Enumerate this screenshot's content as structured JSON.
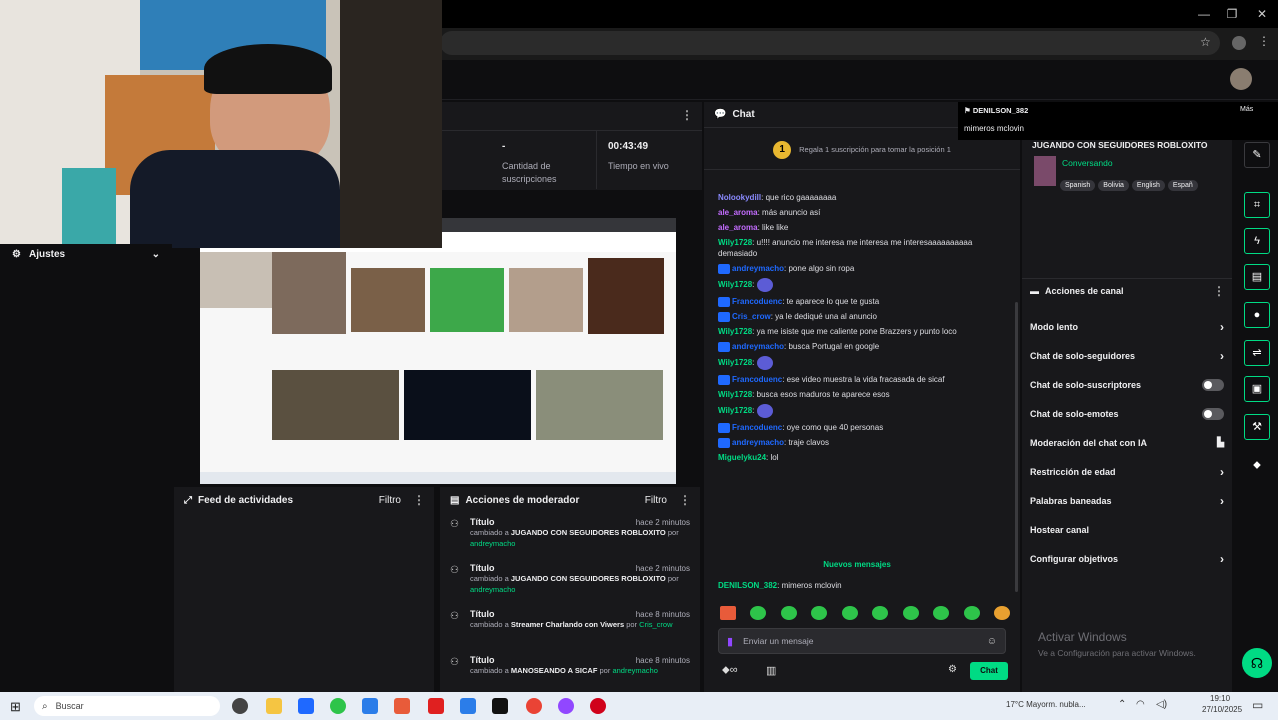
{
  "window": {
    "minimize": "—",
    "maximize": "❐",
    "close": "✕"
  },
  "colors": {
    "accent": "#00db84",
    "twitch_purple": "#9147ff",
    "bg": "#0e0e10",
    "panel": "#18181b"
  },
  "stats": [
    {
      "value": "-",
      "label": "Cantidad de suscripciones"
    },
    {
      "value": "00:43:49",
      "label": "Tiempo en vivo"
    }
  ],
  "ajustes": {
    "label": "Ajustes"
  },
  "feed": {
    "title": "Feed de actividades",
    "filter": "Filtro"
  },
  "mod_actions": {
    "title": "Acciones de moderador",
    "filter": "Filtro",
    "items": [
      {
        "title": "Título",
        "time": "hace 2 minutos",
        "prefix": "cambiado a",
        "value": "JUGANDO CON SEGUIDORES ROBLOXITO",
        "by": "por",
        "user": "andreymacho"
      },
      {
        "title": "Título",
        "time": "hace 2 minutos",
        "prefix": "cambiado a",
        "value": "JUGANDO CON SEGUIDORES ROBLOXITO",
        "by": "por",
        "user": "andreymacho"
      },
      {
        "title": "Título",
        "time": "hace 8 minutos",
        "prefix": "cambiado a",
        "value": "Streamer Charlando con Viwers",
        "by": "por",
        "user": "Cris_crow"
      },
      {
        "title": "Título",
        "time": "hace 8 minutos",
        "prefix": "cambiado a",
        "value": "MANOSEANDO A SICAF",
        "by": "por",
        "user": "andreymacho"
      }
    ]
  },
  "chat": {
    "title": "Chat",
    "pinned": "Regala 1 suscripción para tomar la posición 1",
    "messages": [
      {
        "user": "Nolookydill",
        "color": "#8a8aff",
        "text": ": que rico gaaaaaaaa",
        "badge": false
      },
      {
        "user": "ale_aroma",
        "color": "#c36cff",
        "text": ": más anuncio así",
        "badge": false
      },
      {
        "user": "ale_aroma",
        "color": "#c36cff",
        "text": ": like like",
        "badge": false
      },
      {
        "user": "Wily1728",
        "color": "#00db84",
        "text": ": u!!!! anuncio me interesa me interesa me interesaaaaaaaaaa demasiado",
        "badge": false
      },
      {
        "user": "andreymacho",
        "color": "#1f69ff",
        "text": ": pone algo sin ropa",
        "badge": true
      },
      {
        "user": "Wily1728",
        "color": "#00db84",
        "text": ":",
        "badge": false,
        "emote": true
      },
      {
        "user": "Francoduenc",
        "color": "#1f69ff",
        "text": ": te aparece lo que te gusta",
        "badge": true
      },
      {
        "user": "Cris_crow",
        "color": "#1f69ff",
        "text": ": ya le dediqué una al anuncio",
        "badge": true
      },
      {
        "user": "Wily1728",
        "color": "#00db84",
        "text": ": ya me isiste que me caliente pone Brazzers y punto loco",
        "badge": false
      },
      {
        "user": "andreymacho",
        "color": "#1f69ff",
        "text": ": busca Portugal en google",
        "badge": true
      },
      {
        "user": "Wily1728",
        "color": "#00db84",
        "text": ":",
        "badge": false,
        "emote": true
      },
      {
        "user": "Francoduenc",
        "color": "#1f69ff",
        "text": ": ese video muestra la vida fracasada de sicaf",
        "badge": true
      },
      {
        "user": "Wily1728",
        "color": "#00db84",
        "text": ": busca esos maduros te aparece esos",
        "badge": false
      },
      {
        "user": "Wily1728",
        "color": "#00db84",
        "text": ":",
        "badge": false,
        "emote": true
      },
      {
        "user": "Francoduenc",
        "color": "#1f69ff",
        "text": ": oye como que 40 personas",
        "badge": true
      },
      {
        "user": "andreymacho",
        "color": "#1f69ff",
        "text": ": traje clavos",
        "badge": true
      },
      {
        "user": "Miguelyku24",
        "color": "#00db84",
        "text": ": lol",
        "badge": false
      }
    ],
    "new_messages": "Nuevos mensajes",
    "last": {
      "user": "DENILSON_382",
      "text": ": mimeros mclovin"
    },
    "input_placeholder": "Enviar un mensaje",
    "send_label": "Chat"
  },
  "popup": {
    "user": "DENILSON_382",
    "action": "Más",
    "text": "mimeros mclovin"
  },
  "stream_info": {
    "title": "JUGANDO CON SEGUIDORES ROBLOXITO",
    "category": "Conversando",
    "tags": [
      "Spanish",
      "Bolivia",
      "English",
      "Españ"
    ]
  },
  "channel_actions": {
    "title": "Acciones de canal",
    "items": [
      {
        "label": "Modo lento",
        "control": "chevron"
      },
      {
        "label": "Chat de solo-seguidores",
        "control": "chevron"
      },
      {
        "label": "Chat de solo-suscriptores",
        "control": "toggle"
      },
      {
        "label": "Chat de solo-emotes",
        "control": "toggle"
      },
      {
        "label": "Moderación del chat con IA",
        "control": "chart"
      },
      {
        "label": "Restricción de edad",
        "control": "chevron"
      },
      {
        "label": "Palabras baneadas",
        "control": "chevron"
      },
      {
        "label": "Hostear canal",
        "control": "none"
      },
      {
        "label": "Configurar objetivos",
        "control": "chevron"
      }
    ]
  },
  "watermark": {
    "title": "Activar Windows",
    "subtitle": "Ve a Configuración para activar Windows."
  },
  "taskbar": {
    "search_placeholder": "Buscar",
    "weather": "17°C  Mayorm. nubla...",
    "time": "19:10",
    "date": "27/10/2025"
  }
}
